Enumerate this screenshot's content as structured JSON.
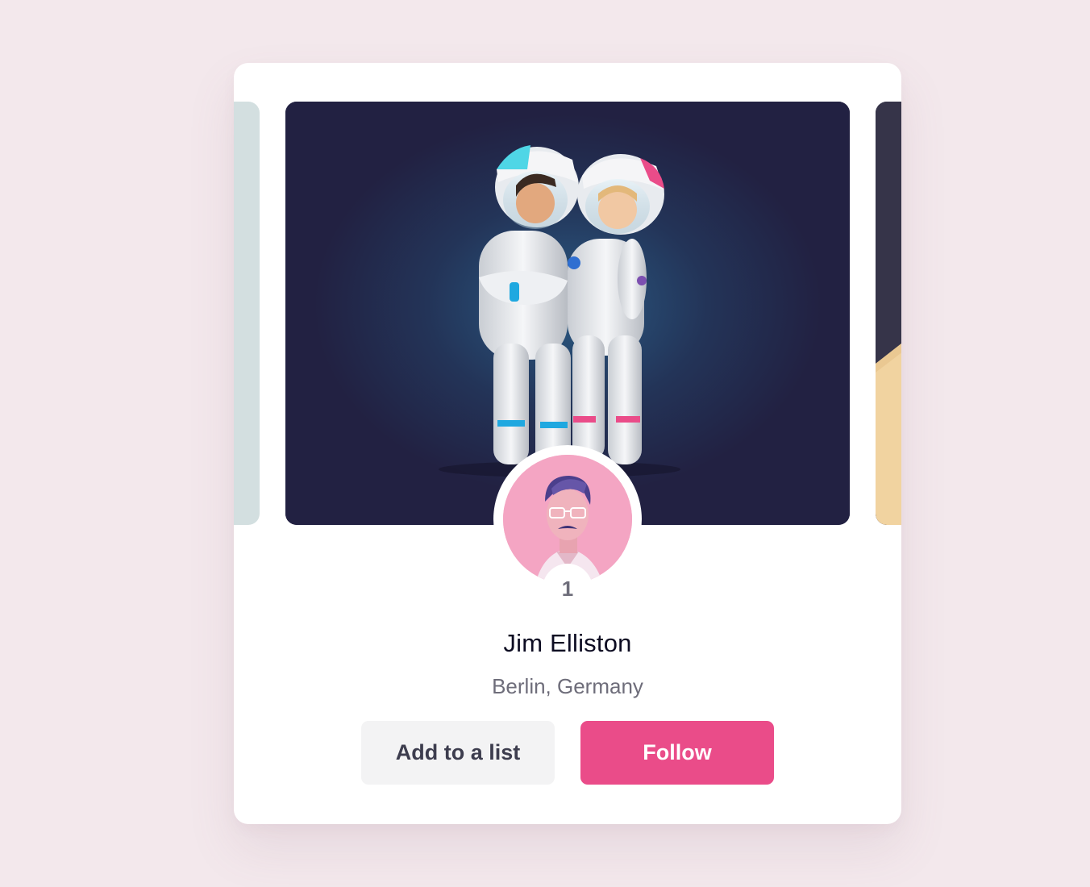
{
  "profile": {
    "name": "Jim Elliston",
    "location": "Berlin, Germany",
    "rank": "1"
  },
  "actions": {
    "add_to_list_label": "Add to a list",
    "follow_label": "Follow"
  },
  "colors": {
    "page_background": "#f3e8ec",
    "card_background": "#ffffff",
    "follow_button": "#ea4c89",
    "secondary_button": "#f3f3f4",
    "name_text": "#0d0c22",
    "muted_text": "#6e6d7a"
  },
  "images": {
    "cover": "astronaut-couple-illustration",
    "avatar": "man-with-glasses-illustration"
  }
}
